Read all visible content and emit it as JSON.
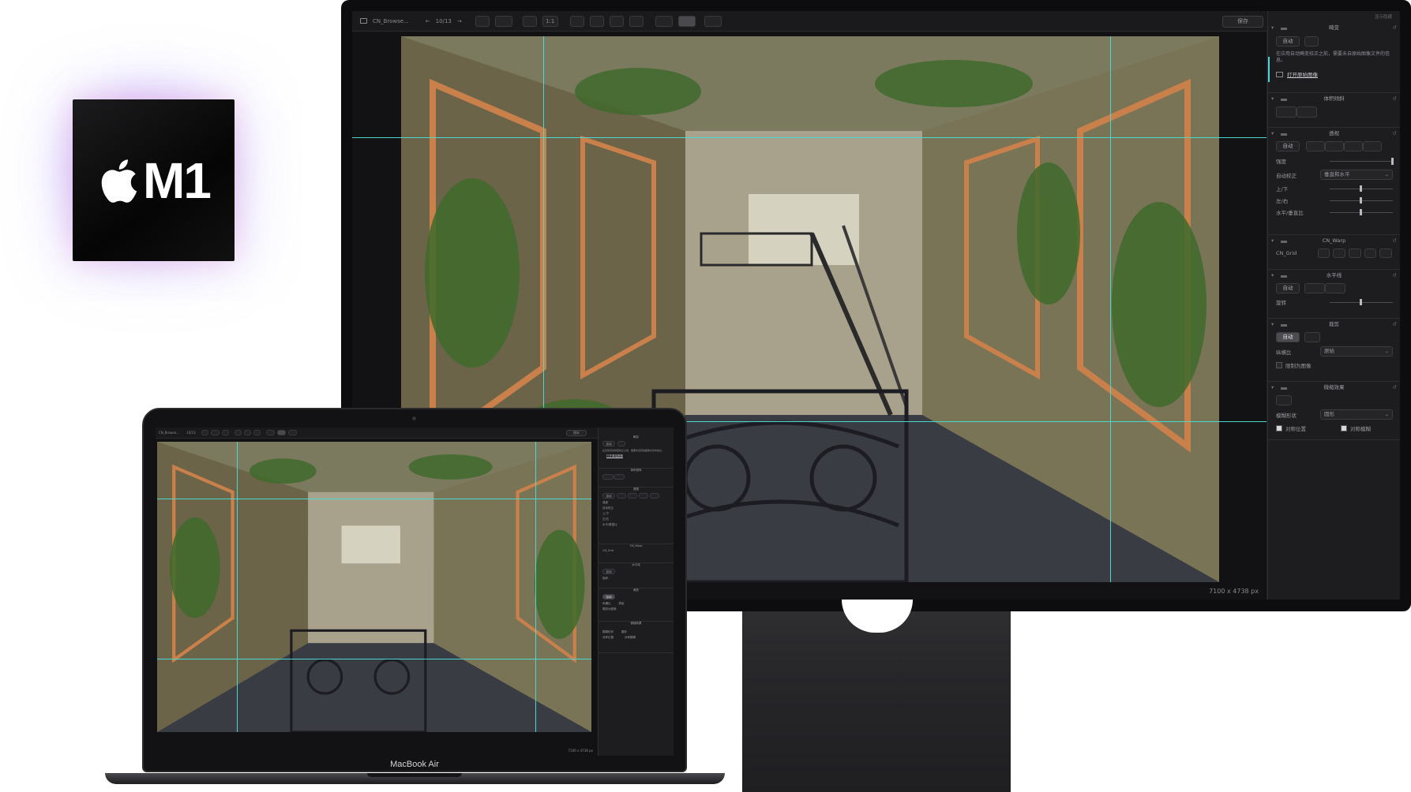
{
  "chip": {
    "label": "M1",
    "icon": "apple-logo-icon"
  },
  "laptop": {
    "brand": "MacBook Air"
  },
  "editor": {
    "folder_name": "CN_Browse...",
    "nav_counter": "10/13",
    "zoom_label": "1:1",
    "save_label": "保存",
    "image_dimensions": "7100 x 4738 px",
    "panel_header": "显示隐藏",
    "sections": {
      "correction": {
        "title": "畸变",
        "auto_label": "自动",
        "note": "在应用自动畸变校正之前，需要未自原始图像文件的信息。",
        "open_original": "打开原始图像"
      },
      "body_tilt": {
        "title": "体积倾斜"
      },
      "perspective": {
        "title": "透视",
        "auto_label": "自动",
        "strength_label": "强度",
        "auto_correct_label": "自动校正",
        "auto_correct_value": "垂直和水平",
        "updown_label": "上/下",
        "leftright_label": "左/右",
        "ratio_label": "水平/垂直比",
        "strength_value": 1.0,
        "updown_value": 0.5,
        "leftright_value": 0.5,
        "ratio_value": 0.5
      },
      "warp": {
        "title": "CN_Warp",
        "grid_label": "CN_Grid"
      },
      "horizon": {
        "title": "水平线",
        "auto_label": "自动",
        "rotate_label": "旋转",
        "rotate_value": 0.5
      },
      "crop": {
        "title": "裁剪",
        "auto_label": "自动",
        "ratio_label": "纵横比",
        "ratio_value": "原始",
        "limit_label": "限制为图像",
        "limit_checked": false
      },
      "tiltshift": {
        "title": "微缩效果",
        "shape_label": "模糊形状",
        "shape_value": "圆形",
        "symmetric_pos_label": "对称位置",
        "symmetric_pos_checked": true,
        "symmetric_blur_label": "对称模糊",
        "symmetric_blur_checked": true
      }
    }
  }
}
